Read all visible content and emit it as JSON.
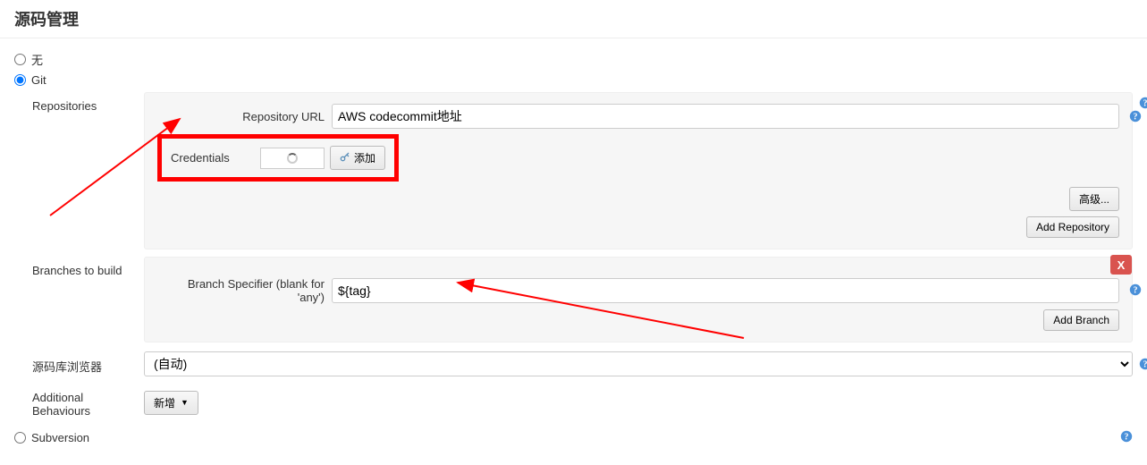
{
  "section": {
    "title": "源码管理"
  },
  "scm_options": {
    "none": {
      "label": "无",
      "selected": false
    },
    "git": {
      "label": "Git",
      "selected": true
    },
    "subversion": {
      "label": "Subversion",
      "selected": false
    }
  },
  "repositories": {
    "section_label": "Repositories",
    "url_label": "Repository URL",
    "url_value": "AWS codecommit地址",
    "credentials_label": "Credentials",
    "add_button": "添加",
    "advanced_button": "高级...",
    "add_repo_button": "Add Repository"
  },
  "branches": {
    "section_label": "Branches to build",
    "specifier_label": "Branch Specifier (blank for 'any')",
    "specifier_value": "${tag}",
    "add_branch_button": "Add Branch",
    "delete_label": "X"
  },
  "browser": {
    "label": "源码库浏览器",
    "value": "(自动)"
  },
  "behaviours": {
    "label": "Additional Behaviours",
    "add_button": "新增"
  }
}
